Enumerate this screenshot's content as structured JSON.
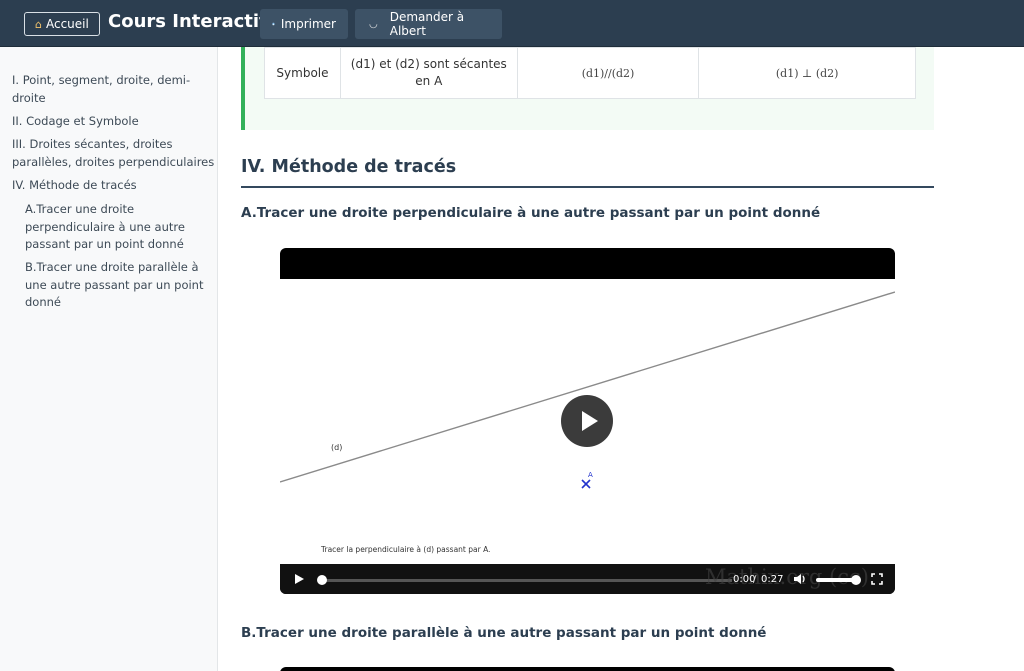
{
  "header": {
    "home_label": "Accueil",
    "brand": "Cours Interactif",
    "print_label": "Imprimer",
    "ask_label": "Demander à Albert"
  },
  "sidebar": {
    "items": [
      {
        "label": "I. Point, segment, droite, demi-droite",
        "lines": [
          "I. Point, segment, droite, demi-",
          "droite"
        ]
      },
      {
        "label": "II. Codage et Symbole",
        "lines": [
          "II. Codage et Symbole"
        ]
      },
      {
        "label": "III. Droites sécantes, droites parallèles, droites perpendiculaires",
        "lines": [
          "III. Droites sécantes, droites",
          "parallèles, droites perpendiculaires"
        ]
      },
      {
        "label": "IV. Méthode de tracés",
        "lines": [
          "IV. Méthode de tracés"
        ]
      },
      {
        "label": "A.Tracer une droite perpendiculaire à une autre passant par un point donné",
        "lines": [
          "A.Tracer une droite",
          "perpendiculaire à une autre",
          "passant par un point donné"
        ]
      },
      {
        "label": "B.Tracer une droite parallèle à une autre passant par un point donné",
        "lines": [
          "B.Tracer une droite parallèle à",
          "une autre passant par un point",
          "donné"
        ]
      }
    ]
  },
  "table": {
    "row_label": "Symbole",
    "secantes_lines": [
      "(d1) et (d2) sont sécantes",
      "en A"
    ],
    "paralleles": "(d1)//(d2)",
    "perpendiculaires": "(d1) ⊥ (d2)"
  },
  "section": {
    "title": "IV. Méthode de tracés",
    "sub_a": "A.Tracer une droite perpendiculaire à une autre passant par un point donné",
    "sub_b": "B.Tracer une droite parallèle à une autre passant par un point donné"
  },
  "video": {
    "line_label": "(d)",
    "point_label": "A",
    "caption": "Tracer la perpendiculaire à (d) passant par A.",
    "watermark": "Mathix.org (cc)",
    "current_time": "0:00",
    "duration": "0:27",
    "progress": 0.0,
    "volume": 0.9
  },
  "colors": {
    "header_bg": "#2c3e50",
    "callout_border": "#33b05a",
    "point_color": "#2233cc"
  }
}
